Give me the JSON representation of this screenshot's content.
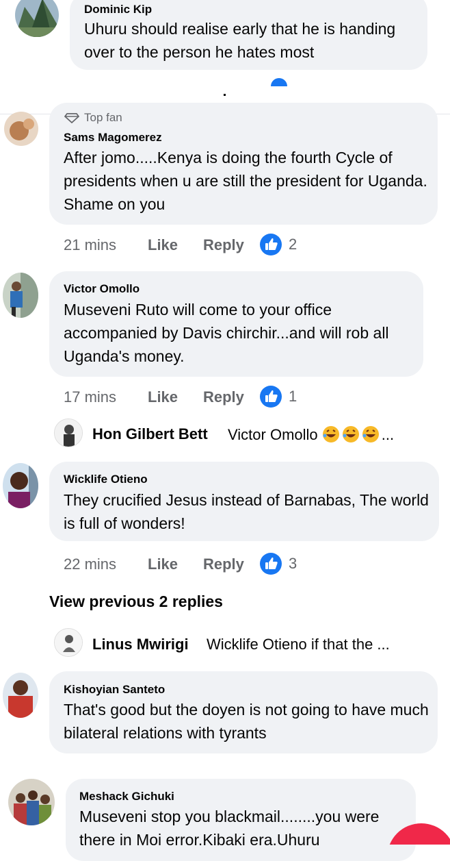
{
  "comments": [
    {
      "name": "Dominic Kip",
      "text": "Uhuru should realise early that he is handing over to the person he hates most"
    },
    {
      "badge": "Top fan",
      "name": "Sams Magomerez",
      "text": "After jomo.....Kenya is doing the fourth Cycle of presidents when u are still the president for Uganda. Shame on you",
      "time": "21 mins",
      "like": "Like",
      "reply": "Reply",
      "reactions": "2"
    },
    {
      "name": "Victor Omollo",
      "text": "Museveni Ruto will come to your office accompanied by Davis chirchir...and will rob all Uganda's money.",
      "time": "17 mins",
      "like": "Like",
      "reply": "Reply",
      "reactions": "1",
      "reply_preview": {
        "name": "Hon Gilbert Bett",
        "text": "Victor Omollo",
        "trailing": "..."
      }
    },
    {
      "name": "Wicklife Otieno",
      "text": "They crucified Jesus instead of Barnabas, The world is full of wonders!",
      "time": "22 mins",
      "like": "Like",
      "reply": "Reply",
      "reactions": "3",
      "view_previous": "View previous 2 replies",
      "reply_preview": {
        "name": "Linus Mwirigi",
        "text": "Wicklife Otieno if that the ..."
      }
    },
    {
      "name": "Kishoyian Santeto",
      "text": "That's good but the doyen is not going to have much bilateral relations with tyrants"
    },
    {
      "name": "Meshack Gichuki",
      "text": "Museveni stop you blackmail........you were there in Moi error.Kibaki era.Uhuru"
    }
  ],
  "icons": {
    "like": "thumbs-up-icon",
    "top_fan": "diamond-badge-icon",
    "laugh": "laughing-emoji-icon"
  },
  "colors": {
    "bubble": "#f0f2f5",
    "like_blue": "#1877f2",
    "meta_gray": "#65676b",
    "fab_red": "#f02849"
  }
}
